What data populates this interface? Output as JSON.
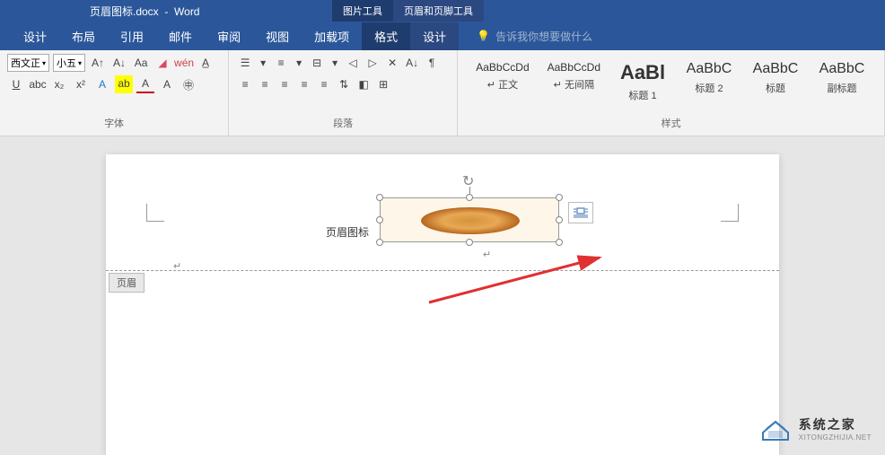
{
  "title": {
    "filename": "页眉图标.docx",
    "app": "Word"
  },
  "context_tabs": {
    "picture_tools": "图片工具",
    "header_footer_tools": "页眉和页脚工具"
  },
  "ribbon_tabs": {
    "design": "设计",
    "layout": "布局",
    "references": "引用",
    "mailings": "邮件",
    "review": "审阅",
    "view": "视图",
    "addins": "加载项",
    "format": "格式",
    "hf_design": "设计"
  },
  "search": {
    "placeholder": "告诉我你想要做什么"
  },
  "font": {
    "name": "西文正",
    "size": "小五",
    "group_label": "字体"
  },
  "paragraph": {
    "group_label": "段落"
  },
  "styles": {
    "group_label": "样式",
    "items": [
      {
        "preview": "AaBbCcDd",
        "name": "↵ 正文"
      },
      {
        "preview": "AaBbCcDd",
        "name": "↵ 无间隔"
      },
      {
        "preview": "AaBl",
        "name": "标题 1"
      },
      {
        "preview": "AaBbC",
        "name": "标题 2"
      },
      {
        "preview": "AaBbC",
        "name": "标题"
      },
      {
        "preview": "AaBbC",
        "name": "副标题"
      }
    ]
  },
  "document": {
    "header_text": "页眉图标",
    "header_tag": "页眉"
  },
  "watermark": {
    "cn": "系统之家",
    "en": "XITONGZHIJIA.NET"
  }
}
